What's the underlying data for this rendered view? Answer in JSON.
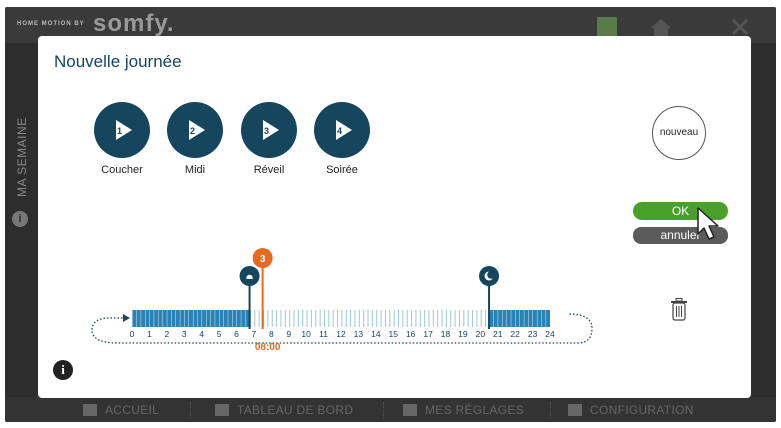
{
  "brand": {
    "small": "HOME MOTION BY",
    "big": "somfy."
  },
  "side": {
    "label": "MA SEMAINE",
    "info_glyph": "i"
  },
  "nav": [
    {
      "label": "ACCUEIL",
      "icon": "home-icon"
    },
    {
      "label": "TABLEAU DE BORD",
      "icon": "dashboard-icon"
    },
    {
      "label": "MES RÉGLAGES",
      "icon": "user-icon"
    },
    {
      "label": "CONFIGURATION",
      "icon": "gear-icon"
    }
  ],
  "dialog": {
    "title": "Nouvelle journée",
    "periods": [
      {
        "num": "1",
        "label": "Coucher"
      },
      {
        "num": "2",
        "label": "Midi"
      },
      {
        "num": "3",
        "label": "Réveil"
      },
      {
        "num": "4",
        "label": "Soirée"
      }
    ],
    "nouveau": "nouveau",
    "ok": "OK",
    "cancel": "annuler",
    "info_glyph": "i"
  },
  "timeline": {
    "ticks": [
      "0",
      "1",
      "2",
      "3",
      "4",
      "5",
      "6",
      "7",
      "8",
      "9",
      "10",
      "11",
      "12",
      "13",
      "14",
      "15",
      "16",
      "17",
      "18",
      "19",
      "20",
      "21",
      "22",
      "23",
      "24"
    ],
    "markers": [
      {
        "type": "sun",
        "hour": 6.75,
        "icon": "sun-icon"
      },
      {
        "type": "period",
        "hour": 7.5,
        "label": "3"
      },
      {
        "type": "moon",
        "hour": 20.5,
        "icon": "moon-icon"
      }
    ],
    "selected_time": "08:00",
    "colors": {
      "primary": "#16455e",
      "accent": "#e86a1f",
      "bar": "#2a83b5"
    }
  }
}
